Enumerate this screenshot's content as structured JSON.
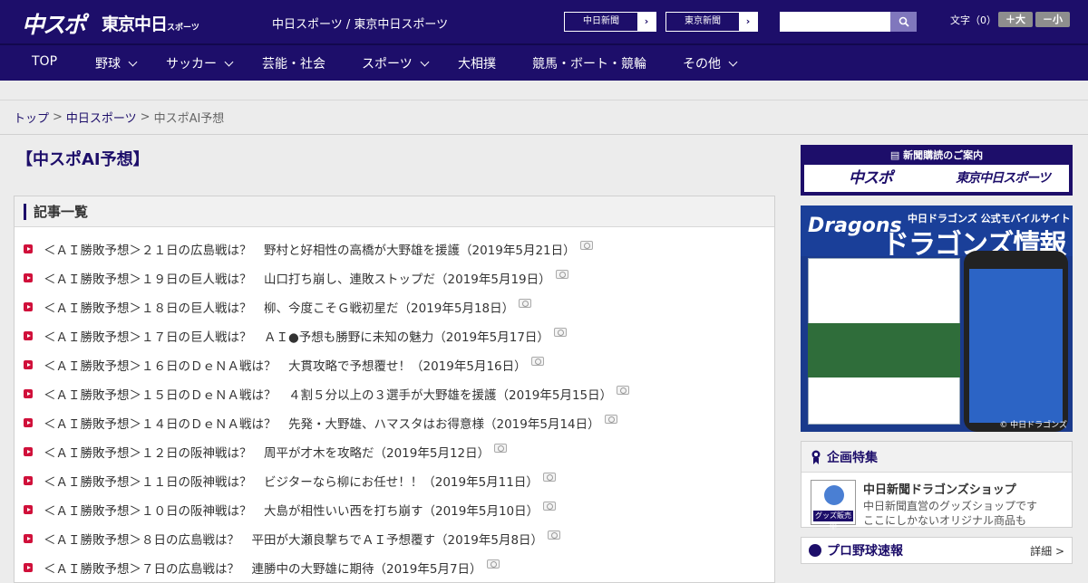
{
  "header": {
    "logo_chuspo": "中スポ",
    "logo_tokyo": "東京中日",
    "logo_tokyo_small": "スポーツ",
    "site_name": "中日スポーツ / 東京中日スポーツ",
    "btn_chunichi": "中日新聞",
    "btn_tokyo": "東京新聞",
    "search_placeholder": "",
    "fontsize_label": "文字（0）",
    "fs_large": "＋大",
    "fs_small": "－小"
  },
  "nav": [
    {
      "label": "TOP",
      "has_sub": false
    },
    {
      "label": "野球",
      "has_sub": true
    },
    {
      "label": "サッカー",
      "has_sub": true
    },
    {
      "label": "芸能・社会",
      "has_sub": false
    },
    {
      "label": "スポーツ",
      "has_sub": true
    },
    {
      "label": "大相撲",
      "has_sub": false
    },
    {
      "label": "競馬・ボート・競輪",
      "has_sub": false
    },
    {
      "label": "その他",
      "has_sub": true
    }
  ],
  "breadcrumb": {
    "home": "トップ",
    "section": "中日スポーツ",
    "current": "中スポAI予想",
    "sep": ">"
  },
  "page_title": "【中スポAI予想】",
  "articles_heading": "記事一覧",
  "articles": [
    "＜ＡＩ勝敗予想＞２１日の広島戦は？　野村と好相性の高橋が大野雄を援護（2019年5月21日）",
    "＜ＡＩ勝敗予想＞１９日の巨人戦は？　山口打ち崩し、連敗ストップだ（2019年5月19日）",
    "＜ＡＩ勝敗予想＞１８日の巨人戦は？　柳、今度こそＧ戦初星だ（2019年5月18日）",
    "＜ＡＩ勝敗予想＞１７日の巨人戦は？　ＡＩ●予想も勝野に未知の魅力（2019年5月17日）",
    "＜ＡＩ勝敗予想＞１６日のＤｅＮＡ戦は？　大貫攻略で予想覆せ！（2019年5月16日）",
    "＜ＡＩ勝敗予想＞１５日のＤｅＮＡ戦は？　４割５分以上の３選手が大野雄を援護（2019年5月15日）",
    "＜ＡＩ勝敗予想＞１４日のＤｅＮＡ戦は？　先発・大野雄、ハマスタはお得意様（2019年5月14日）",
    "＜ＡＩ勝敗予想＞１２日の阪神戦は？　周平が才木を攻略だ（2019年5月12日）",
    "＜ＡＩ勝敗予想＞１１日の阪神戦は？　ビジターなら柳にお任せ！！（2019年5月11日）",
    "＜ＡＩ勝敗予想＞１０日の阪神戦は？　大島が相性いい西を打ち崩す（2019年5月10日）",
    "＜ＡＩ勝敗予想＞８日の広島戦は？　平田が大瀬良撃ちでＡＩ予想覆す（2019年5月8日）",
    "＜ＡＩ勝敗予想＞７日の広島戦は？　連勝中の大野雄に期待（2019年5月7日）"
  ],
  "sidebar": {
    "subscribe_head": "新聞購読のご案内",
    "sub_logo1": "中スポ",
    "sub_logo2": "東京中日スポーツ",
    "banner": {
      "brand": "Dragons",
      "subtitle": "中日ドラゴンズ 公式モバイルサイト",
      "title": "ドラゴンズ情報",
      "copyright": "© 中日ドラゴンズ"
    },
    "feature_head": "企画特集",
    "feature_title": "中日新聞ドラゴンズショップ",
    "feature_desc1": "中日新聞直営のグッズショップです",
    "feature_desc2": "ここにしかないオリジナル商品も",
    "feature_thumb_label": "グッズ販売中",
    "baseball_head": "プロ野球速報",
    "baseball_more": "詳細 >"
  },
  "colors": {
    "brand_navy": "#1d0e6a",
    "bullet_red": "#d0103a"
  }
}
